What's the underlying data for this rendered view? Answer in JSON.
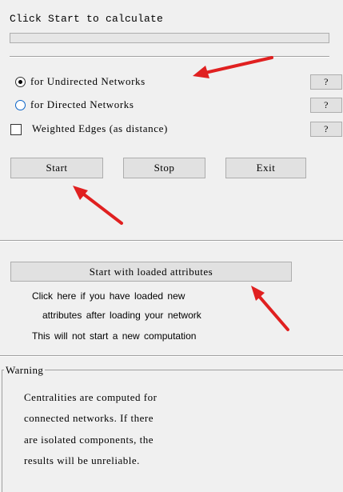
{
  "status": {
    "text": "Click Start to calculate",
    "progress_percent": 0
  },
  "options": {
    "undirected": {
      "label": "for Undirected Networks",
      "checked": true
    },
    "directed": {
      "label": "for Directed Networks",
      "checked": false
    },
    "weighted": {
      "label": "Weighted Edges (as distance)",
      "checked": false
    },
    "help_label": "?"
  },
  "buttons": {
    "start": "Start",
    "stop": "Stop",
    "exit": "Exit",
    "start_loaded": "Start with loaded attributes"
  },
  "info": {
    "line1": "Click here if you have loaded new",
    "line2": "attributes after loading your network",
    "line3": "This will not start a new computation"
  },
  "warning": {
    "title": "Warning",
    "lines": [
      "Centralities are computed for",
      "connected networks. If there",
      "are isolated components, the",
      "results will be unreliable."
    ]
  },
  "colors": {
    "annotation_arrow": "#e02020",
    "progress": "#06b025",
    "radio_ring": "#0a64c8"
  }
}
